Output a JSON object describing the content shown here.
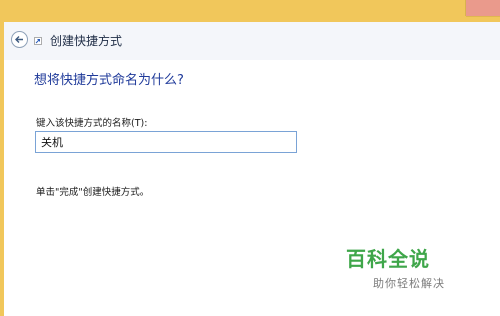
{
  "window": {
    "frame_color": "#f1c75b",
    "close_button_color": "#ea9a8c"
  },
  "header": {
    "back_icon": "back-arrow-icon",
    "title": "创建快捷方式"
  },
  "main": {
    "question": "想将快捷方式命名为什么?",
    "name_label": "键入该快捷方式的名称(T):",
    "name_value": "关机",
    "hint": "单击\"完成\"创建快捷方式。"
  },
  "watermark": {
    "title": "百科全说",
    "subtitle": "助你轻松解决"
  }
}
